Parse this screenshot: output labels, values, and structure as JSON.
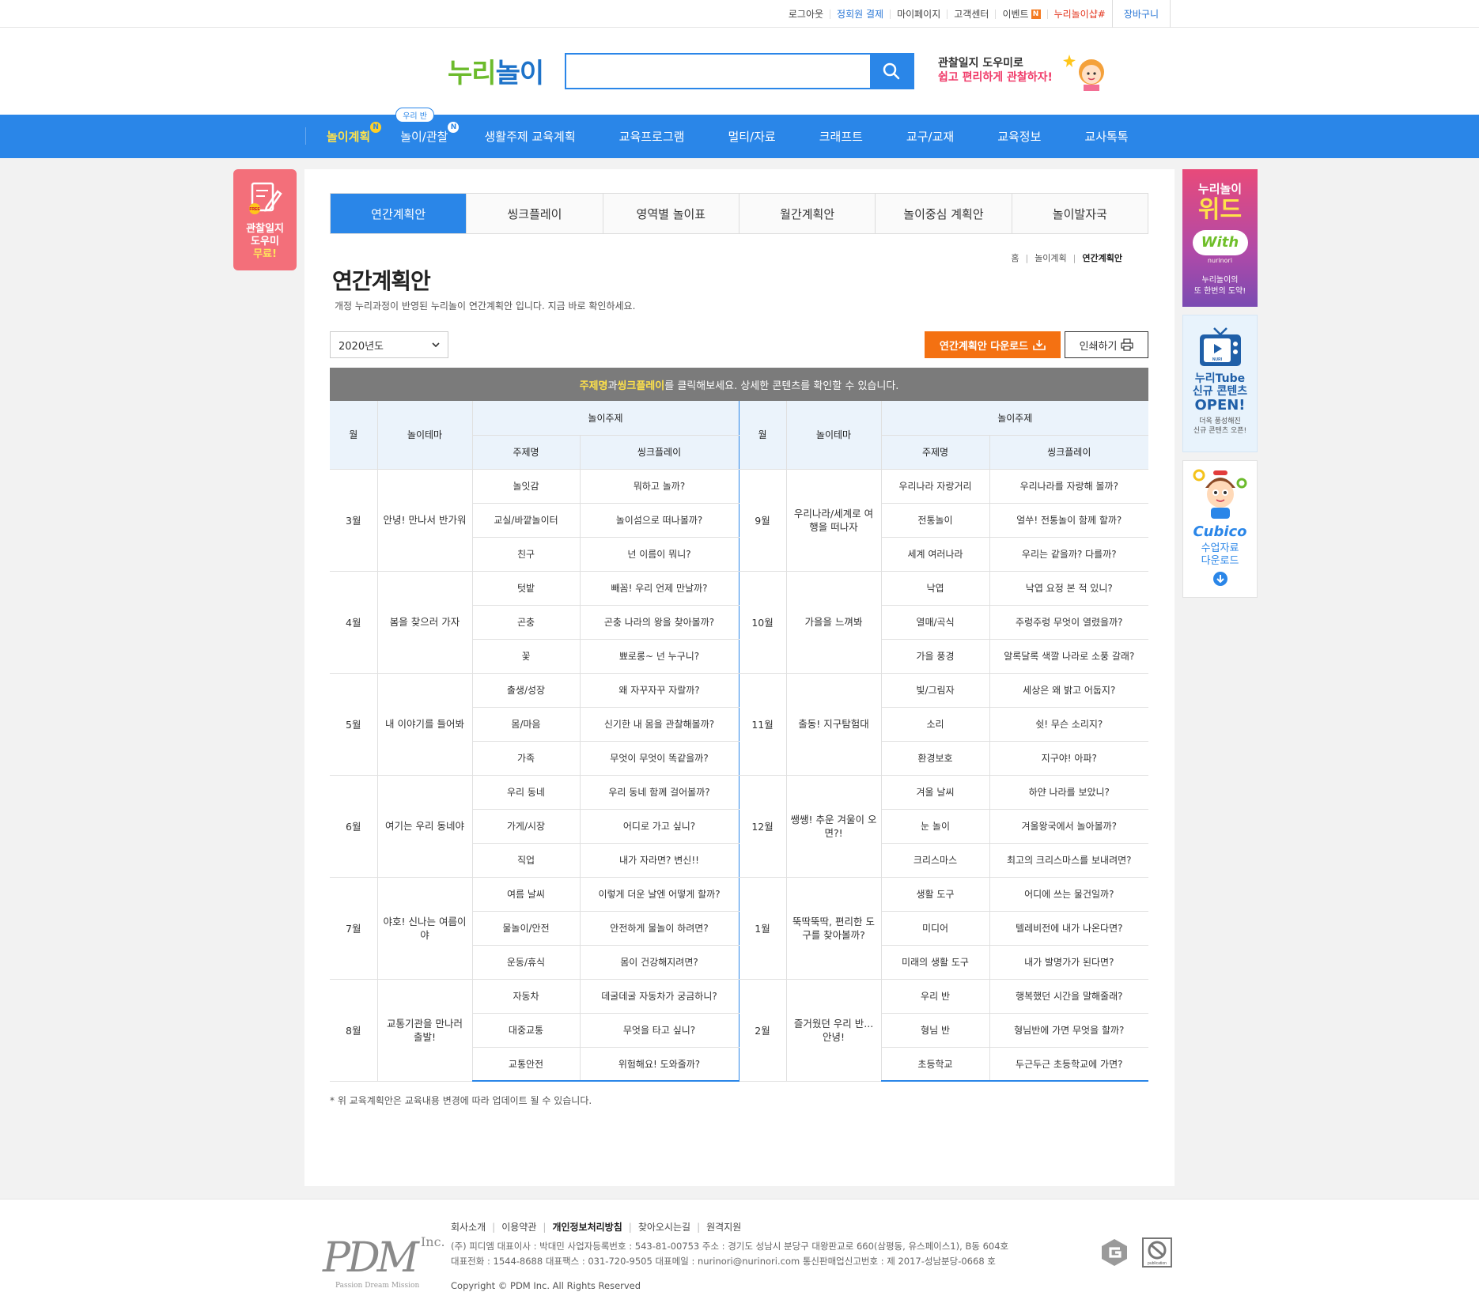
{
  "util": {
    "items": [
      "로그아웃",
      "정회원 결제",
      "마이페이지",
      "고객센터",
      "이벤트"
    ],
    "event_badge": "N",
    "shop": "누리놀이샵#",
    "cart": "장바구니"
  },
  "header": {
    "logo_part1": "누리",
    "logo_part2": "놀이",
    "search_placeholder": "",
    "promo_line1": "관찰일지 도우미로",
    "promo_line2": "쉽고 편리하게 관찰하자!"
  },
  "gnb": {
    "items": [
      "놀이계획",
      "놀이/관찰",
      "생활주제 교육계획",
      "교육프로그램",
      "멀티/자료",
      "크래프트",
      "교구/교재",
      "교육정보",
      "교사톡톡"
    ],
    "badge": "N",
    "tag": "우리 반"
  },
  "left_banner": {
    "line1": "관찰일지",
    "line2": "도우미",
    "line3": "무료!",
    "free": "FREE"
  },
  "right_banners": {
    "b1_line1": "누리놀이",
    "b1_line2": "위드",
    "b1_line3": "누리놀이의",
    "b1_line4": "또 한번의 도약!",
    "b1_logo": "With",
    "b1_sub": "nurinori",
    "b2_icon": "NURI",
    "b2_line1": "누리Tube",
    "b2_line2": "신규 콘텐츠",
    "b2_line3": "OPEN!",
    "b2_line4": "더욱 풍성해진",
    "b2_line5": "신규 콘텐츠 오픈!",
    "b3_logo": "Cubico",
    "b3_line1": "수업자료",
    "b3_line2": "다운로드"
  },
  "tabs": [
    "연간계획안",
    "씽크플레이",
    "영역별 놀이표",
    "월간계획안",
    "놀이중심 계획안",
    "놀이발자국"
  ],
  "breadcrumb": [
    "홈",
    "놀이계획",
    "연간계획안"
  ],
  "page": {
    "title": "연간계획안",
    "desc": "개정 누리과정이 반영된 누리놀이 연간계획안 입니다. 지금 바로 확인하세요.",
    "year": "2020년도",
    "download": "연간계획안 다운로드",
    "print": "인쇄하기",
    "notice_a": "주제명",
    "notice_b": "과 ",
    "notice_c": "씽크플레이",
    "notice_d": "를 클릭해보세요. 상세한 콘텐츠를 확인할 수 있습니다.",
    "footnote": "* 위 교육계획안은 교육내용 변경에 따라 업데이트 될 수 있습니다."
  },
  "table": {
    "h_month": "월",
    "h_theme": "놀이테마",
    "h_topic": "놀이주제",
    "h_name": "주제명",
    "h_think": "씽크플레이",
    "left": [
      {
        "month": "3월",
        "theme": "안녕! 만나서 반가워",
        "rows": [
          [
            "놀잇감",
            "뭐하고 놀까?"
          ],
          [
            "교실/바깥놀이터",
            "놀이섬으로 떠나볼까?"
          ],
          [
            "친구",
            "넌 이름이 뭐니?"
          ]
        ]
      },
      {
        "month": "4월",
        "theme": "봄을 찾으러 가자",
        "rows": [
          [
            "텃밭",
            "빼꼼! 우리 언제 만날까?"
          ],
          [
            "곤충",
            "곤충 나라의 왕을 찾아볼까?"
          ],
          [
            "꽃",
            "뾰로롱~ 넌 누구니?"
          ]
        ]
      },
      {
        "month": "5월",
        "theme": "내 이야기를 들어봐",
        "rows": [
          [
            "출생/성장",
            "왜 자꾸자꾸 자랄까?"
          ],
          [
            "몸/마음",
            "신기한 내 몸을 관찰해볼까?"
          ],
          [
            "가족",
            "무엇이 무엇이 똑같을까?"
          ]
        ]
      },
      {
        "month": "6월",
        "theme": "여기는 우리 동네야",
        "rows": [
          [
            "우리 동네",
            "우리 동네 함께 걸어볼까?"
          ],
          [
            "가게/시장",
            "어디로 가고 싶니?"
          ],
          [
            "직업",
            "내가 자라면? 변신!!"
          ]
        ]
      },
      {
        "month": "7월",
        "theme": "야호! 신나는 여름이야",
        "rows": [
          [
            "여름 날씨",
            "이렇게 더운 날엔 어떻게 할까?"
          ],
          [
            "물놀이/안전",
            "안전하게 물놀이 하려면?"
          ],
          [
            "운동/휴식",
            "몸이 건강해지려면?"
          ]
        ]
      },
      {
        "month": "8월",
        "theme": "교통기관을 만나러 출발!",
        "rows": [
          [
            "자동차",
            "데굴데굴 자동차가 궁금하니?"
          ],
          [
            "대중교통",
            "무엇을 타고 싶니?"
          ],
          [
            "교통안전",
            "위험해요! 도와줄까?"
          ]
        ]
      }
    ],
    "right": [
      {
        "month": "9월",
        "theme": "우리나라/세계로 여행을 떠나자",
        "rows": [
          [
            "우리나라 자랑거리",
            "우리나라를 자랑해 볼까?"
          ],
          [
            "전통놀이",
            "얼쑤! 전통놀이 함께 할까?"
          ],
          [
            "세계 여러나라",
            "우리는 같을까? 다를까?"
          ]
        ]
      },
      {
        "month": "10월",
        "theme": "가을을 느껴봐",
        "rows": [
          [
            "낙엽",
            "낙엽 요정 본 적 있니?"
          ],
          [
            "열매/곡식",
            "주렁주렁 무엇이 열렸을까?"
          ],
          [
            "가을 풍경",
            "알록달록 색깔 나라로 소풍 갈래?"
          ]
        ]
      },
      {
        "month": "11월",
        "theme": "출동! 지구탐험대",
        "rows": [
          [
            "빛/그림자",
            "세상은 왜 밝고 어둡지?"
          ],
          [
            "소리",
            "쉿! 무슨 소리지?"
          ],
          [
            "환경보호",
            "지구야! 아파?"
          ]
        ]
      },
      {
        "month": "12월",
        "theme": "쌩쌩! 추운 겨울이 오면?!",
        "rows": [
          [
            "겨울 날씨",
            "하얀 나라를 보았니?"
          ],
          [
            "눈 놀이",
            "겨울왕국에서 놀아볼까?"
          ],
          [
            "크리스마스",
            "최고의 크리스마스를 보내려면?"
          ]
        ]
      },
      {
        "month": "1월",
        "theme": "뚝딱뚝딱, 편리한 도구를 찾아볼까?",
        "rows": [
          [
            "생활 도구",
            "어디에 쓰는 물건일까?"
          ],
          [
            "미디어",
            "텔레비전에 내가 나온다면?"
          ],
          [
            "미래의 생활 도구",
            "내가 발명가가 된다면?"
          ]
        ]
      },
      {
        "month": "2월",
        "theme": "즐거웠던 우리 반... 안녕!",
        "rows": [
          [
            "우리 반",
            "행복했던 시간을 말해줄래?"
          ],
          [
            "형님 반",
            "형님반에 가면 무엇을 할까?"
          ],
          [
            "초등학교",
            "두근두근 초등학교에 가면?"
          ]
        ]
      }
    ]
  },
  "footer": {
    "links": [
      "회사소개",
      "이용약관",
      "개인정보처리방침",
      "찾아오시는길",
      "원격지원"
    ],
    "info1": "(주) 피디엠 대표이사 : 박대민 사업자등록번호 : 543-81-00753 주소 : 경기도 성남시 분당구 대왕판교로 660(삼평동, 유스페이스1), B동 604호",
    "info2": "대표전화 : 1544-8688 대표팩스 : 031-720-9505 대표메일 : nurinori@nurinori.com 통신판매업신고번호 : 제 2017-성남분당-0668 호",
    "copyright": "Copyright © PDM Inc. All Rights Reserved",
    "logo": "PDM",
    "logo_inc": "Inc.",
    "logo_sub": "Passion Dream Mission",
    "mark2": "publication"
  }
}
